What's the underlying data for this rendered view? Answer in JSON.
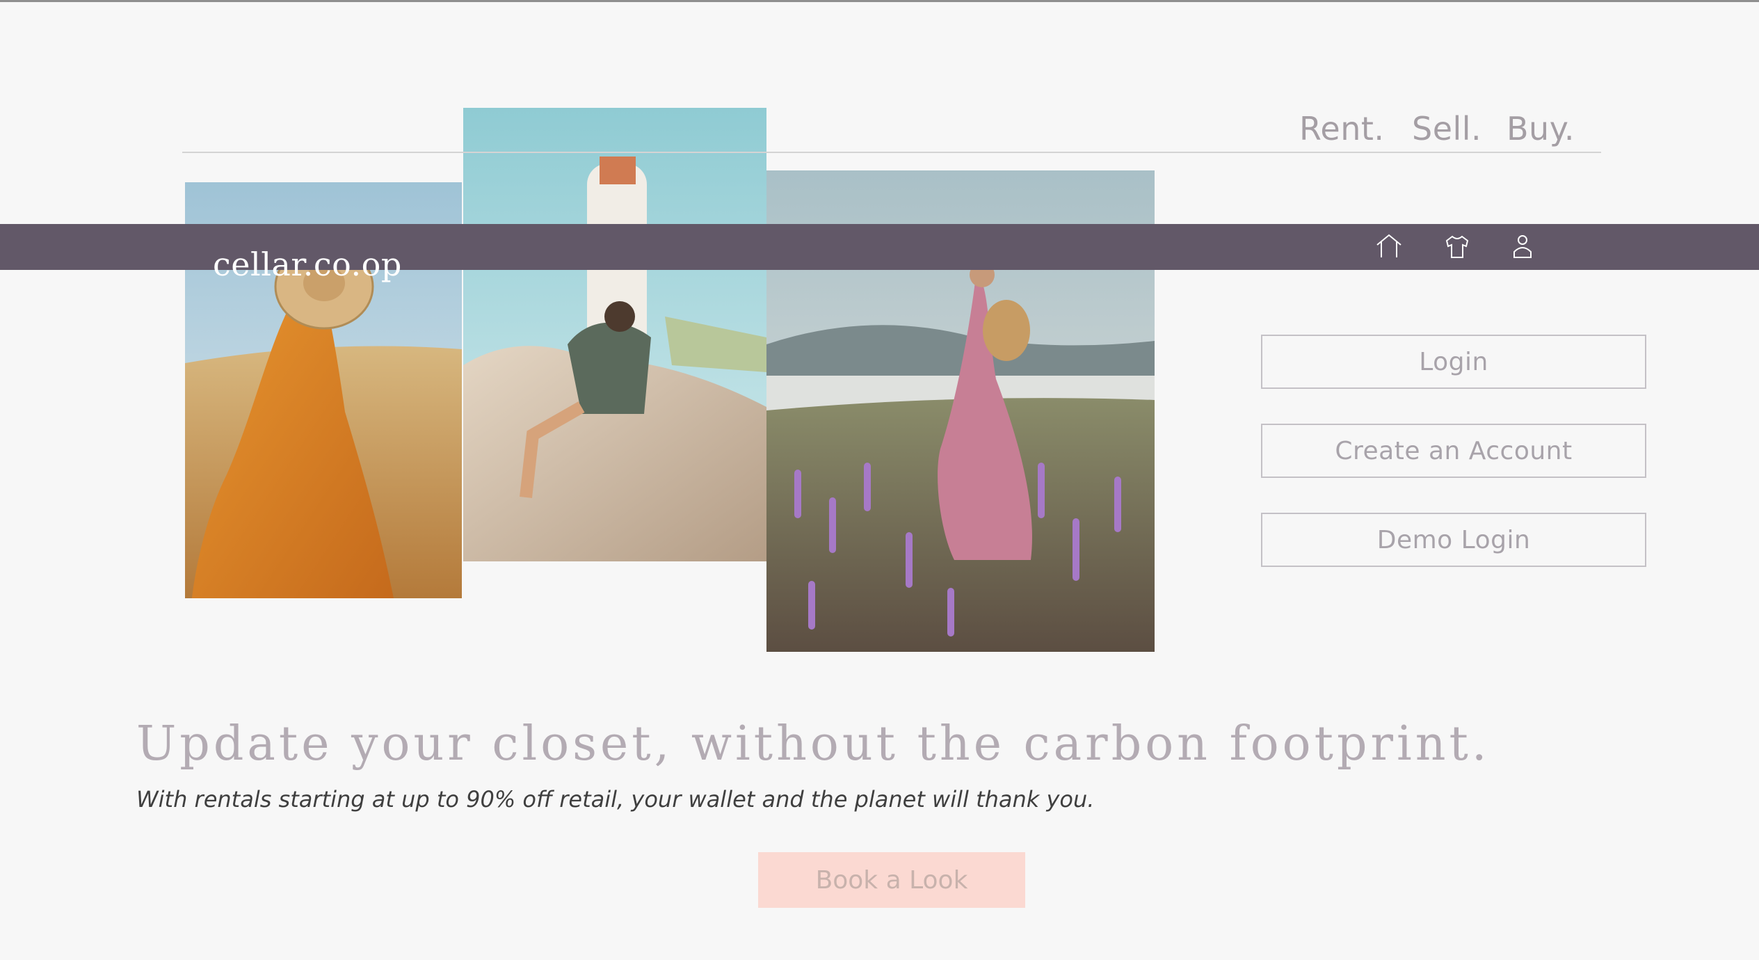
{
  "header": {
    "tagline": [
      "Rent.",
      "Sell.",
      "Buy."
    ]
  },
  "navbar": {
    "logo": "cellar.co.op",
    "icons": [
      "home-icon",
      "shirt-icon",
      "user-icon"
    ],
    "background_color": "#625868"
  },
  "auth": {
    "login_label": "Login",
    "create_account_label": "Create an Account",
    "demo_login_label": "Demo Login"
  },
  "hero": {
    "headline": "Update your closet, without the carbon footprint.",
    "subheadline": "With rentals starting at up to 90% off retail, your wallet and the planet will thank you.",
    "cta_label": "Book a Look",
    "cta_color": "#fbd9d2"
  },
  "photos": [
    "woman in orange dress and sun hat in golden field",
    "woman with binoculars sitting on rock by lighthouse",
    "woman in plaid dress in lupine field by lake"
  ]
}
